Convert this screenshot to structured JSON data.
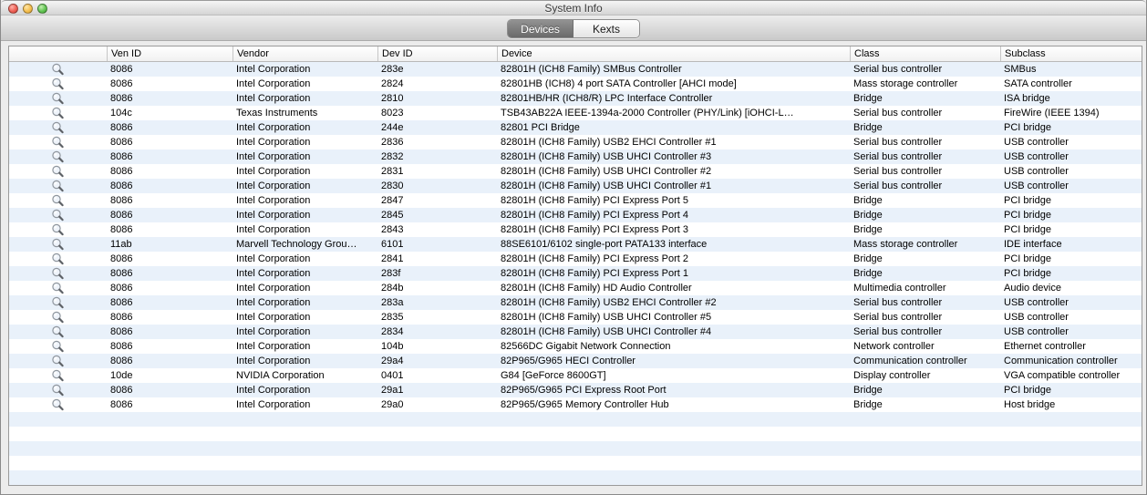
{
  "window": {
    "title": "System Info"
  },
  "tabs": {
    "devices": {
      "label": "Devices",
      "selected": true
    },
    "kexts": {
      "label": "Kexts",
      "selected": false
    }
  },
  "colors": {
    "stripe_blue": "#e9f1fa",
    "selected_segment": "#6a6a6a",
    "traffic_red": "#ee6156",
    "traffic_yellow": "#f5bf4f",
    "traffic_green": "#62c554"
  },
  "table": {
    "columns": {
      "ven_id": "Ven ID",
      "vendor": "Vendor",
      "dev_id": "Dev ID",
      "device": "Device",
      "cls": "Class",
      "subclass": "Subclass"
    },
    "row_icon": "magnifier-icon",
    "rows": [
      {
        "ven_id": "8086",
        "vendor": "Intel Corporation",
        "dev_id": "283e",
        "device": "82801H (ICH8 Family) SMBus Controller",
        "cls": "Serial bus controller",
        "subclass": "SMBus"
      },
      {
        "ven_id": "8086",
        "vendor": "Intel Corporation",
        "dev_id": "2824",
        "device": "82801HB (ICH8) 4 port SATA Controller [AHCI mode]",
        "cls": "Mass storage controller",
        "subclass": "SATA controller"
      },
      {
        "ven_id": "8086",
        "vendor": "Intel Corporation",
        "dev_id": "2810",
        "device": "82801HB/HR (ICH8/R) LPC Interface Controller",
        "cls": "Bridge",
        "subclass": "ISA bridge"
      },
      {
        "ven_id": "104c",
        "vendor": "Texas Instruments",
        "dev_id": "8023",
        "device": "TSB43AB22A IEEE-1394a-2000 Controller (PHY/Link) [iOHCI-L…",
        "cls": "Serial bus controller",
        "subclass": "FireWire (IEEE 1394)"
      },
      {
        "ven_id": "8086",
        "vendor": "Intel Corporation",
        "dev_id": "244e",
        "device": "82801 PCI Bridge",
        "cls": "Bridge",
        "subclass": "PCI bridge"
      },
      {
        "ven_id": "8086",
        "vendor": "Intel Corporation",
        "dev_id": "2836",
        "device": "82801H (ICH8 Family) USB2 EHCI Controller #1",
        "cls": "Serial bus controller",
        "subclass": "USB controller"
      },
      {
        "ven_id": "8086",
        "vendor": "Intel Corporation",
        "dev_id": "2832",
        "device": "82801H (ICH8 Family) USB UHCI Controller #3",
        "cls": "Serial bus controller",
        "subclass": "USB controller"
      },
      {
        "ven_id": "8086",
        "vendor": "Intel Corporation",
        "dev_id": "2831",
        "device": "82801H (ICH8 Family) USB UHCI Controller #2",
        "cls": "Serial bus controller",
        "subclass": "USB controller"
      },
      {
        "ven_id": "8086",
        "vendor": "Intel Corporation",
        "dev_id": "2830",
        "device": "82801H (ICH8 Family) USB UHCI Controller #1",
        "cls": "Serial bus controller",
        "subclass": "USB controller"
      },
      {
        "ven_id": "8086",
        "vendor": "Intel Corporation",
        "dev_id": "2847",
        "device": "82801H (ICH8 Family) PCI Express Port 5",
        "cls": "Bridge",
        "subclass": "PCI bridge"
      },
      {
        "ven_id": "8086",
        "vendor": "Intel Corporation",
        "dev_id": "2845",
        "device": "82801H (ICH8 Family) PCI Express Port 4",
        "cls": "Bridge",
        "subclass": "PCI bridge"
      },
      {
        "ven_id": "8086",
        "vendor": "Intel Corporation",
        "dev_id": "2843",
        "device": "82801H (ICH8 Family) PCI Express Port 3",
        "cls": "Bridge",
        "subclass": "PCI bridge"
      },
      {
        "ven_id": "11ab",
        "vendor": "Marvell Technology Grou…",
        "dev_id": "6101",
        "device": "88SE6101/6102 single-port PATA133 interface",
        "cls": "Mass storage controller",
        "subclass": "IDE interface"
      },
      {
        "ven_id": "8086",
        "vendor": "Intel Corporation",
        "dev_id": "2841",
        "device": "82801H (ICH8 Family) PCI Express Port 2",
        "cls": "Bridge",
        "subclass": "PCI bridge"
      },
      {
        "ven_id": "8086",
        "vendor": "Intel Corporation",
        "dev_id": "283f",
        "device": "82801H (ICH8 Family) PCI Express Port 1",
        "cls": "Bridge",
        "subclass": "PCI bridge"
      },
      {
        "ven_id": "8086",
        "vendor": "Intel Corporation",
        "dev_id": "284b",
        "device": "82801H (ICH8 Family) HD Audio Controller",
        "cls": "Multimedia controller",
        "subclass": "Audio device"
      },
      {
        "ven_id": "8086",
        "vendor": "Intel Corporation",
        "dev_id": "283a",
        "device": "82801H (ICH8 Family) USB2 EHCI Controller #2",
        "cls": "Serial bus controller",
        "subclass": "USB controller"
      },
      {
        "ven_id": "8086",
        "vendor": "Intel Corporation",
        "dev_id": "2835",
        "device": "82801H (ICH8 Family) USB UHCI Controller #5",
        "cls": "Serial bus controller",
        "subclass": "USB controller"
      },
      {
        "ven_id": "8086",
        "vendor": "Intel Corporation",
        "dev_id": "2834",
        "device": "82801H (ICH8 Family) USB UHCI Controller #4",
        "cls": "Serial bus controller",
        "subclass": "USB controller"
      },
      {
        "ven_id": "8086",
        "vendor": "Intel Corporation",
        "dev_id": "104b",
        "device": "82566DC Gigabit Network Connection",
        "cls": "Network controller",
        "subclass": "Ethernet controller"
      },
      {
        "ven_id": "8086",
        "vendor": "Intel Corporation",
        "dev_id": "29a4",
        "device": "82P965/G965 HECI Controller",
        "cls": "Communication controller",
        "subclass": "Communication controller"
      },
      {
        "ven_id": "10de",
        "vendor": "NVIDIA Corporation",
        "dev_id": "0401",
        "device": "G84 [GeForce 8600GT]",
        "cls": "Display controller",
        "subclass": "VGA compatible controller"
      },
      {
        "ven_id": "8086",
        "vendor": "Intel Corporation",
        "dev_id": "29a1",
        "device": "82P965/G965 PCI Express Root Port",
        "cls": "Bridge",
        "subclass": "PCI bridge"
      },
      {
        "ven_id": "8086",
        "vendor": "Intel Corporation",
        "dev_id": "29a0",
        "device": "82P965/G965 Memory Controller Hub",
        "cls": "Bridge",
        "subclass": "Host bridge"
      }
    ]
  }
}
